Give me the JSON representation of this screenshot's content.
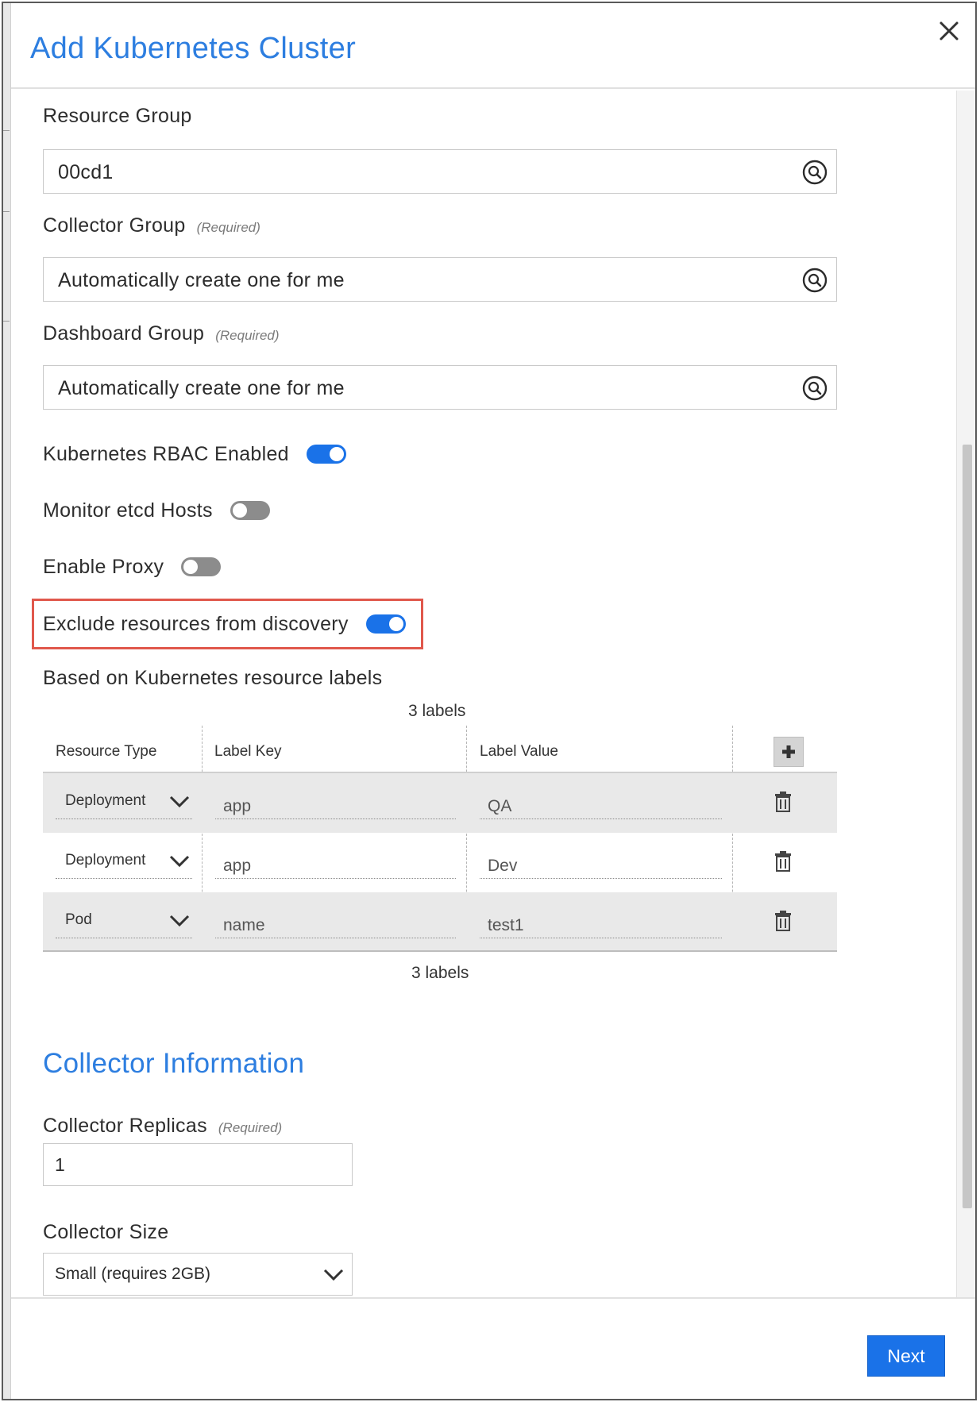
{
  "dialog": {
    "title": "Add Kubernetes Cluster",
    "close_icon": "close-icon"
  },
  "resource_group": {
    "label": "Resource Group",
    "value": "00cd1"
  },
  "collector_group": {
    "label": "Collector Group",
    "required": "(Required)",
    "value": "Automatically create one for me"
  },
  "dashboard_group": {
    "label": "Dashboard Group",
    "required": "(Required)",
    "value": "Automatically create one for me"
  },
  "toggles": {
    "rbac": {
      "label": "Kubernetes RBAC Enabled",
      "on": true
    },
    "etcd": {
      "label": "Monitor etcd Hosts",
      "on": false
    },
    "proxy": {
      "label": "Enable Proxy",
      "on": false
    },
    "exclude": {
      "label": "Exclude resources from discovery",
      "on": true
    }
  },
  "labels_section": {
    "subtitle": "Based on Kubernetes resource labels",
    "count_top": "3 labels",
    "count_bottom": "3 labels",
    "columns": [
      "Resource Type",
      "Label Key",
      "Label Value"
    ],
    "rows": [
      {
        "type": "Deployment",
        "key": "app",
        "value": "QA"
      },
      {
        "type": "Deployment",
        "key": "app",
        "value": "Dev"
      },
      {
        "type": "Pod",
        "key": "name",
        "value": "test1"
      }
    ]
  },
  "collector_info": {
    "title": "Collector Information",
    "replicas_label": "Collector Replicas",
    "replicas_required": "(Required)",
    "replicas_value": "1",
    "size_label": "Collector Size",
    "size_value": "Small (requires 2GB)"
  },
  "footer": {
    "next_label": "Next"
  },
  "colors": {
    "accent": "#2d7ee0",
    "toggle_on": "#1a72e8",
    "toggle_off": "#8c8c8c",
    "highlight": "#e0584c"
  }
}
